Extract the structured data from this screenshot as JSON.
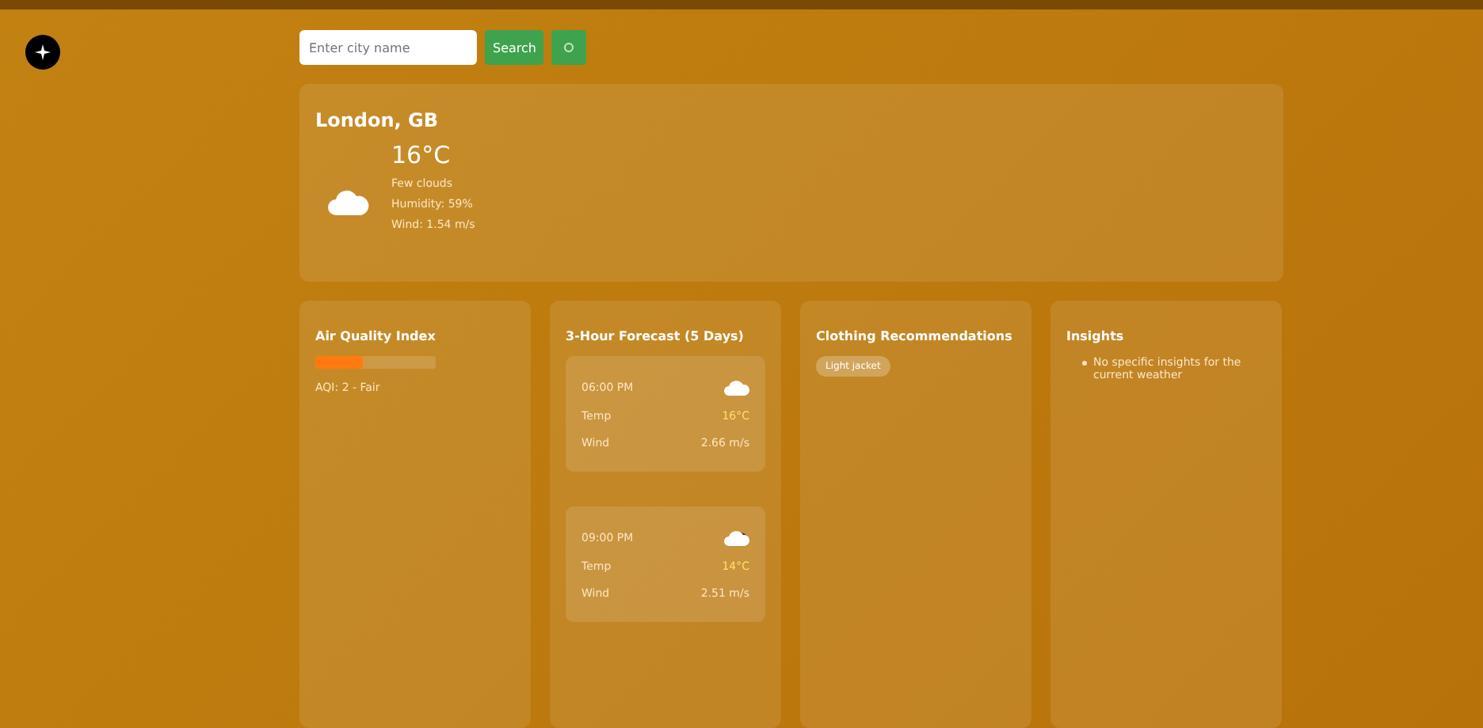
{
  "search": {
    "placeholder": "Enter city name",
    "button": "Search"
  },
  "current": {
    "location": "London, GB",
    "temperature": "16°C",
    "description": "Few clouds",
    "humidity": "Humidity: 59%",
    "wind": "Wind: 1.54 m/s"
  },
  "air_quality": {
    "title": "Air Quality Index",
    "level": 0.4,
    "reading": "AQI: 2 - Fair"
  },
  "forecast": {
    "title": "3-Hour Forecast (5 Days)",
    "items": [
      {
        "time": "06:00 PM",
        "kind": "cloud",
        "temp_label": "Temp",
        "temp": "16°C",
        "wind_label": "Wind",
        "wind": "2.66 m/s"
      },
      {
        "time": "09:00 PM",
        "kind": "night",
        "temp_label": "Temp",
        "temp": "14°C",
        "wind_label": "Wind",
        "wind": "2.51 m/s"
      }
    ]
  },
  "clothing": {
    "title": "Clothing Recommendations",
    "tags": [
      "Light jacket"
    ]
  },
  "insights": {
    "title": "Insights",
    "items": [
      "No specific insights for the current weather"
    ]
  }
}
